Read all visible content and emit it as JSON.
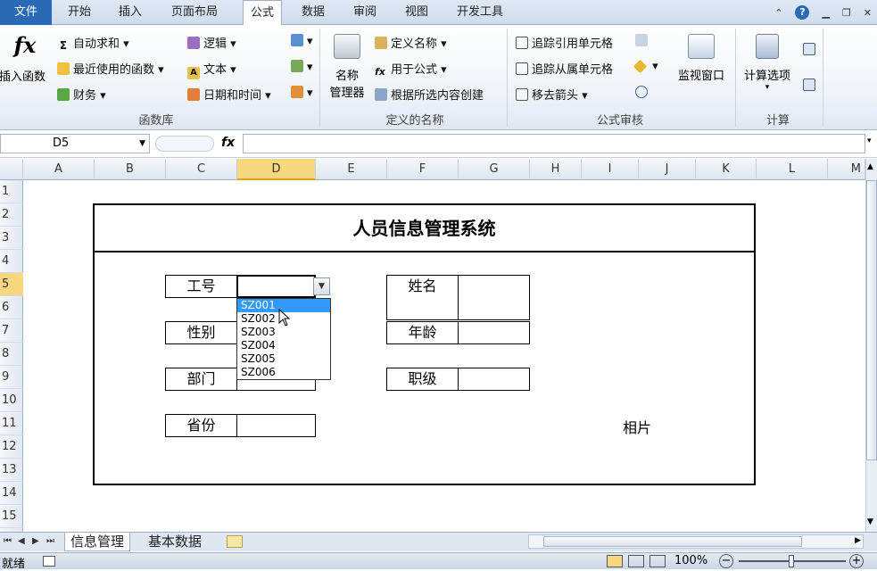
{
  "tabs": {
    "file": "文件",
    "items": [
      "开始",
      "插入",
      "页面布局",
      "公式",
      "数据",
      "审阅",
      "视图",
      "开发工具"
    ],
    "active": "公式"
  },
  "ribbon": {
    "insert_function": "插入函数",
    "function_library": {
      "autosum": "自动求和",
      "recent": "最近使用的函数",
      "financial": "财务",
      "logical": "逻辑",
      "text": "文本",
      "datetime": "日期和时间",
      "label": "函数库"
    },
    "defined_names": {
      "name_manager_line1": "名称",
      "name_manager_line2": "管理器",
      "define_name": "定义名称",
      "use_in_formula": "用于公式",
      "create_from_selection": "根据所选内容创建",
      "label": "定义的名称"
    },
    "formula_auditing": {
      "trace_precedents": "追踪引用单元格",
      "trace_dependents": "追踪从属单元格",
      "remove_arrows": "移去箭头",
      "watch_window": "监视窗口",
      "label": "公式审核"
    },
    "calculation": {
      "options": "计算选项",
      "label": "计算"
    }
  },
  "formula_bar": {
    "name_box": "D5",
    "fx": "fx",
    "content": ""
  },
  "columns": [
    "A",
    "B",
    "C",
    "D",
    "E",
    "F",
    "G",
    "H",
    "I",
    "J",
    "K",
    "L",
    "M"
  ],
  "selected_column": "D",
  "rows": [
    "1",
    "2",
    "3",
    "4",
    "5",
    "6",
    "7",
    "8",
    "9",
    "10",
    "11",
    "12",
    "13",
    "14",
    "15"
  ],
  "selected_row": "5",
  "form": {
    "title": "人员信息管理系统",
    "labels": {
      "employee_id": "工号",
      "gender": "性别",
      "department": "部门",
      "province": "省份",
      "name": "姓名",
      "age": "年龄",
      "grade": "职级",
      "photo": "相片"
    }
  },
  "dropdown": {
    "items": [
      "SZ001",
      "SZ002",
      "SZ003",
      "SZ004",
      "SZ005",
      "SZ006"
    ],
    "highlighted": "SZ001"
  },
  "sheets": {
    "items": [
      "信息管理",
      "基本数据"
    ],
    "active": "信息管理"
  },
  "status": {
    "mode": "就绪",
    "zoom": "100%"
  }
}
